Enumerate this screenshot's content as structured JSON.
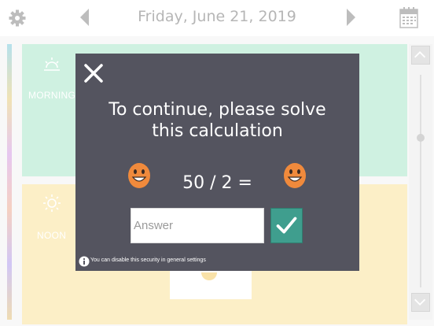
{
  "header": {
    "date": "Friday, June 21, 2019",
    "icons": {
      "settings": "gear-icon",
      "previous": "chevron-left-icon",
      "next": "chevron-right-icon",
      "calendar": "calendar-icon"
    }
  },
  "schedule": {
    "periods": [
      {
        "label": "MORNING",
        "color": "#b6ead2",
        "icon": "sun-rising-icon"
      },
      {
        "label": "NOON",
        "color": "#fbe7a9",
        "icon": "sun-icon"
      }
    ]
  },
  "modal": {
    "title": "To continue, please solve this calculation",
    "equation": "50 / 2 =",
    "answer_placeholder": "Answer",
    "answer_value": "",
    "info": "You can disable this security in general settings",
    "colors": {
      "background": "#54545f",
      "confirm": "#3f9e8e",
      "smiley": "#f08a3c"
    },
    "icons": {
      "close": "close-icon",
      "confirm": "checkmark-icon",
      "smiley": "smiley-face-icon",
      "info": "info-icon"
    }
  }
}
